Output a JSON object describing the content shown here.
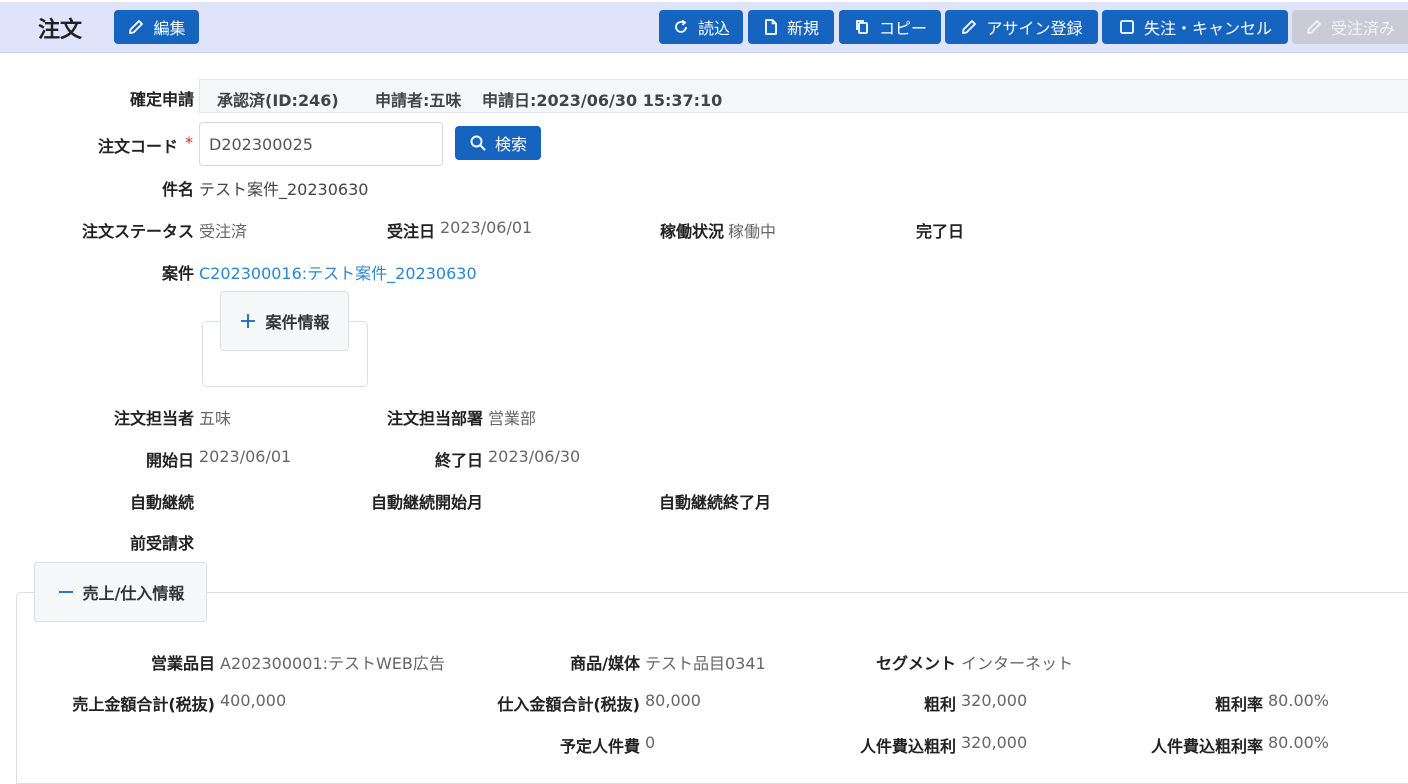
{
  "header": {
    "title": "注文",
    "edit_label": "編集",
    "buttons": {
      "reload": "読込",
      "new": "新規",
      "copy": "コピー",
      "assign": "アサイン登録",
      "lost_cancel": "失注・キャンセル",
      "ordered": "受注済み"
    }
  },
  "approval": {
    "label": "確定申請",
    "status": "承認済(ID:246)",
    "applicant": "申請者:五味",
    "applied_at": "申請日:2023/06/30 15:37:10"
  },
  "order_code": {
    "label": "注文コード",
    "required_mark": "*",
    "value": "D202300025",
    "search_label": "検索"
  },
  "fields": {
    "subject_label": "件名",
    "subject_value": "テスト案件_20230630",
    "status_label": "注文ステータス",
    "status_value": "受注済",
    "order_date_label": "受注日",
    "order_date_value": "2023/06/01",
    "operation_label": "稼働状況",
    "operation_value": "稼働中",
    "complete_label": "完了日",
    "project_label": "案件",
    "project_link": "C202300016:テスト案件_20230630",
    "project_info_label": "案件情報",
    "person_label": "注文担当者",
    "person_value": "五味",
    "dept_label": "注文担当部署",
    "dept_value": "営業部",
    "start_label": "開始日",
    "start_value": "2023/06/01",
    "end_label": "終了日",
    "end_value": "2023/06/30",
    "auto_label": "自動継続",
    "auto_start_label": "自動継続開始月",
    "auto_end_label": "自動継続終了月",
    "prebill_label": "前受請求"
  },
  "sales": {
    "section_label": "売上/仕入情報",
    "item_label": "営業品目",
    "item_value": "A202300001:テストWEB広告",
    "product_label": "商品/媒体",
    "product_value": "テスト品目0341",
    "segment_label": "セグメント",
    "segment_value": "インターネット",
    "sales_total_label": "売上金額合計(税抜)",
    "sales_total_value": "400,000",
    "purchase_total_label": "仕入金額合計(税抜)",
    "purchase_total_value": "80,000",
    "gross_label": "粗利",
    "gross_value": "320,000",
    "gross_rate_label": "粗利率",
    "gross_rate_value": "80.00%",
    "labor_label": "予定人件費",
    "labor_value": "0",
    "gross_labor_label": "人件費込粗利",
    "gross_labor_value": "320,000",
    "gross_labor_rate_label": "人件費込粗利率",
    "gross_labor_rate_value": "80.00%"
  },
  "colors": {
    "header_bg": "#dfe4fb",
    "button": "#1565c0",
    "button_disabled": "#c9ccd6",
    "link": "#2a86d1",
    "required": "#d32f2f"
  }
}
